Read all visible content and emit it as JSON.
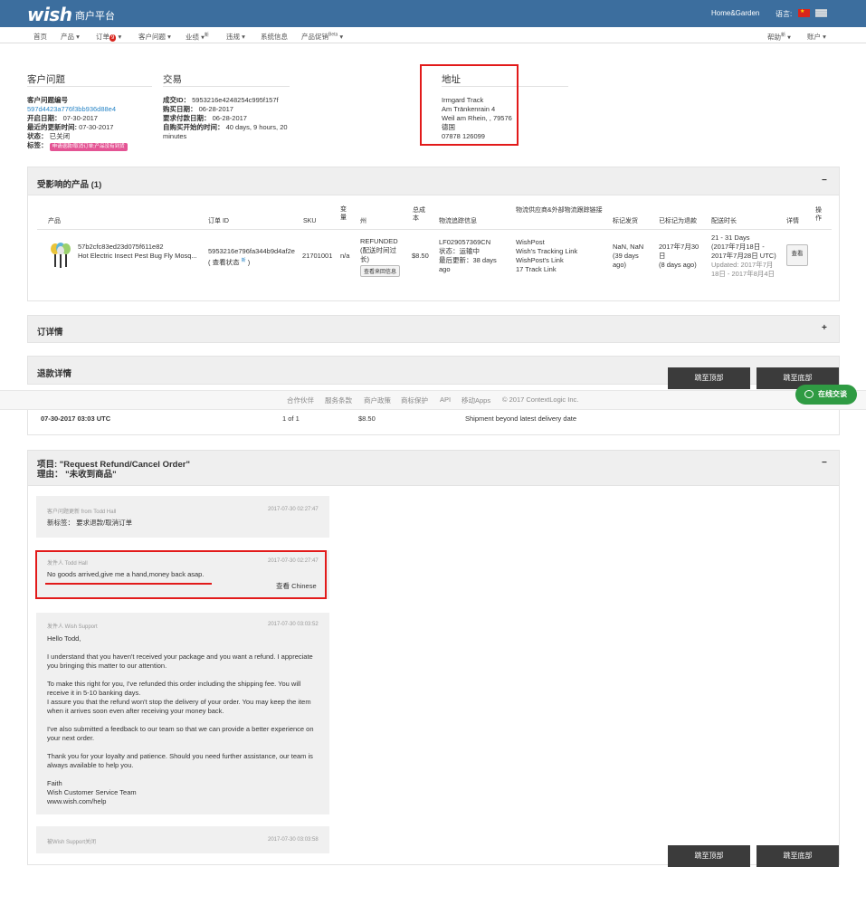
{
  "header": {
    "logo": "wish",
    "platform": "商户平台",
    "category": "Home&Garden",
    "language_label": "语言:"
  },
  "nav": {
    "items": [
      {
        "label": "首页"
      },
      {
        "label": "产品 ▾"
      },
      {
        "label": "订单",
        "badge": "9",
        "suffix": "▾"
      },
      {
        "label": "客户问题 ▾"
      },
      {
        "label": "业绩 ▾",
        "sup": "新"
      },
      {
        "label": "违规 ▾"
      },
      {
        "label": "系统信息"
      },
      {
        "label": "产品促销",
        "sup": "Beta",
        "suffix": "▾"
      }
    ],
    "help": "帮助",
    "help_sup": "新",
    "help_suffix": "▾",
    "account": "账户 ▾"
  },
  "customer_issue": {
    "title": "客户问题",
    "id_label": "客户问题编号",
    "id_value": "597d4423a776f3bb936d88e4",
    "opened_label": "开启日期：",
    "opened_value": "07-30-2017",
    "updated_label": "最近的更新时间:",
    "updated_value": "07-30-2017",
    "status_label": "状态：",
    "status_value": "已关闭",
    "tag_label": "标签：",
    "tag_value": "申请退款/取消订单;产品没有到货"
  },
  "transaction": {
    "title": "交易",
    "txn_label": "成交ID：",
    "txn_value": "5953216e4248254c995f157f",
    "purchase_label": "购买日期：",
    "purchase_value": "06-28-2017",
    "refund_req_label": "要求付款日期：",
    "refund_req_value": "06-28-2017",
    "since_label": "自购买开始的时间：",
    "since_value": "40 days, 9 hours, 20 minutes"
  },
  "address": {
    "title": "地址",
    "lines": [
      "Irmgard Track",
      "Am Tränkenrain 4",
      "Weil am Rhein, , 79576",
      "德国",
      "07878 126099"
    ]
  },
  "affected": {
    "title": "受影响的产品 (1)",
    "toggle": "−",
    "headers": {
      "product": "产品",
      "order_id": "订单 ID",
      "sku": "SKU",
      "variant": "变量",
      "state": "州",
      "cost": "总成本",
      "tracking": "物流追踪信息",
      "provider": "物流供应商&外部物流跟踪链接",
      "mark_ship": "标记发货",
      "marked_refund": "已标记为退款",
      "delivery": "配送时长",
      "detail": "详情",
      "action": "操作"
    },
    "row": {
      "product_id": "57b2cfc83ed23d075f611e82",
      "product_name": "Hot Electric Insect Pest Bug Fly Mosq...",
      "order_id": "5953216e796fa344b9d4af2e",
      "view_status": "( 查看状态 ",
      "view_status_sup": "新",
      "view_status_end": " )",
      "sku": "21701001",
      "variant": "n/a",
      "state": "REFUNDED",
      "state_note": "(配送时间过长)",
      "state_btn": "查看来回信息",
      "cost": "$8.50",
      "tracking_no": "LF029057369CN",
      "tracking_status_label": "状态：",
      "tracking_status": "运输中",
      "tracking_updated_label": "最后更新：",
      "tracking_updated": "38 days ago",
      "provider_name": "WishPost",
      "provider_link1": "Wish's Tracking Link",
      "provider_link2": "WishPost's Link",
      "provider_link3": "17 Track Link",
      "mark_ship": "NaN, NaN (39 days ago)",
      "marked_refund": "2017年7月30日",
      "marked_refund_ago": "(8 days ago)",
      "delivery_range": "21 - 31 Days",
      "delivery_dates": "(2017年7月18日 - 2017年7月28日 UTC)",
      "delivery_updated": "Updated: 2017年7月18日 - 2017年8月4日",
      "detail_btn": "查看"
    }
  },
  "order_detail": {
    "title": "订详情",
    "toggle": "+"
  },
  "refund_detail": {
    "title": "退款详情",
    "row": {
      "date": "07-30-2017 03:03 UTC",
      "count": "1 of 1",
      "amount": "$8.50",
      "reason": "Shipment beyond latest delivery date"
    }
  },
  "buttons": {
    "to_top": "跳至顶部",
    "to_bottom": "跳至底部"
  },
  "footer": {
    "items": [
      "合作伙伴",
      "服务条款",
      "商户政策",
      "商标保护",
      "API",
      "移动Apps",
      "© 2017 ContextLogic Inc."
    ]
  },
  "chat": {
    "label": "在线交谈"
  },
  "issue": {
    "title_line1": "项目: \"Request Refund/Cancel Order\"",
    "title_line2": "理由： \"未收到商品\"",
    "toggle": "−",
    "messages": [
      {
        "from": "客户问题更新 from Todd Hall",
        "date": "2017-07-30 02:27:47",
        "body": [
          "新标签： 要求退款/取消订单"
        ]
      },
      {
        "from": "发件人 Todd Hall",
        "date": "2017-07-30 02:27:47",
        "body": [
          "No goods arrived,give me a hand,money back asap."
        ],
        "translate_label": "查看",
        "translate_lang": "Chinese"
      },
      {
        "from": "发件人 Wish Support",
        "date": "2017-07-30 03:03:52",
        "body": [
          "Hello Todd,",
          "",
          "I understand that you haven't received your package and you want a refund. I appreciate you bringing this matter to our attention.",
          "",
          "To make this right for you, I've refunded this order including the shipping fee. You will receive it in 5-10 banking days.",
          "I assure you that the refund won't stop the delivery of your order. You may keep the item when it arrives soon even after receiving your money back.",
          "",
          "I've also submitted a feedback to our team so that we can provide a better experience on your next order.",
          "",
          "Thank you for your loyalty and patience. Should you need further assistance, our team is always available to help you.",
          "",
          "Faith",
          "Wish Customer Service Team",
          "www.wish.com/help"
        ]
      },
      {
        "from": "被Wish Support关闭",
        "date": "2017-07-30 03:03:58",
        "body": []
      }
    ]
  },
  "colors": {
    "topbar": "#3c6e9e",
    "link": "#2a86c7",
    "highlight": "#e21a1a",
    "chat": "#2f9b43"
  }
}
